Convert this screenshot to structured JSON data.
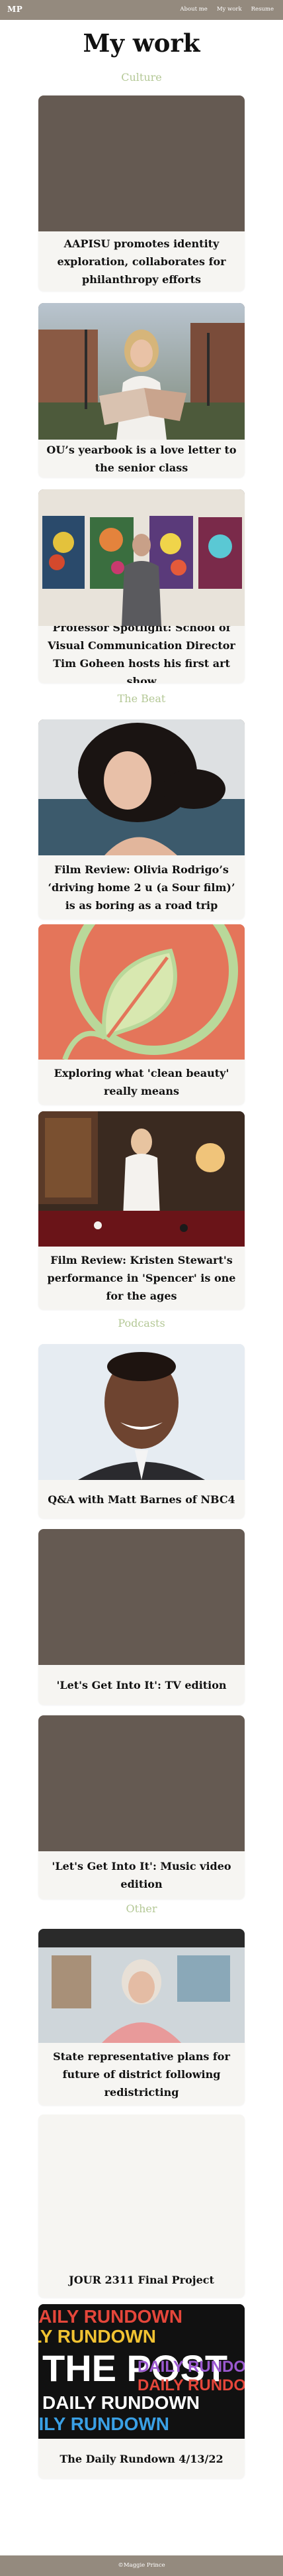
{
  "header": {
    "logo": "MP",
    "nav": [
      "About me",
      "My work",
      "Resume"
    ]
  },
  "page_title": "My work",
  "sections": {
    "culture": "Culture",
    "the_beat": "The Beat",
    "podcasts": "Podcasts",
    "other": "Other"
  },
  "cards": [
    {
      "title": "AAPISU promotes identity exploration, collaborates for philanthropy efforts"
    },
    {
      "title": "OU’s yearbook is a love letter to the senior class"
    },
    {
      "title": "Professor Spotlight: School of Visual Communication Director Tim Goheen hosts his first art show"
    },
    {
      "title": "Film Review: Olivia Rodrigo’s ‘driving home 2 u (a Sour film)’ is as boring as a road trip"
    },
    {
      "title": "Exploring what 'clean beauty' really means"
    },
    {
      "title": "Film Review: Kristen Stewart's performance in 'Spencer' is one for the ages"
    },
    {
      "title": "Q&A with Matt Barnes of NBC4"
    },
    {
      "title": "'Let's Get Into It': TV edition"
    },
    {
      "title": "'Let's Get Into It': Music video edition"
    },
    {
      "title": "State representative plans for future of district following redistricting"
    },
    {
      "title": "JOUR 2311 Final Project"
    },
    {
      "title": "The Daily Rundown 4/13/22",
      "image_text": {
        "brand": "THE POST",
        "repeat": "DAILY RUNDOWN"
      }
    }
  ],
  "footer": "©Maggie Prince",
  "colors": {
    "bar": "#948a7e",
    "section": "#b4c896",
    "card": "#f6f5f2",
    "placeholder": "#655a52"
  }
}
